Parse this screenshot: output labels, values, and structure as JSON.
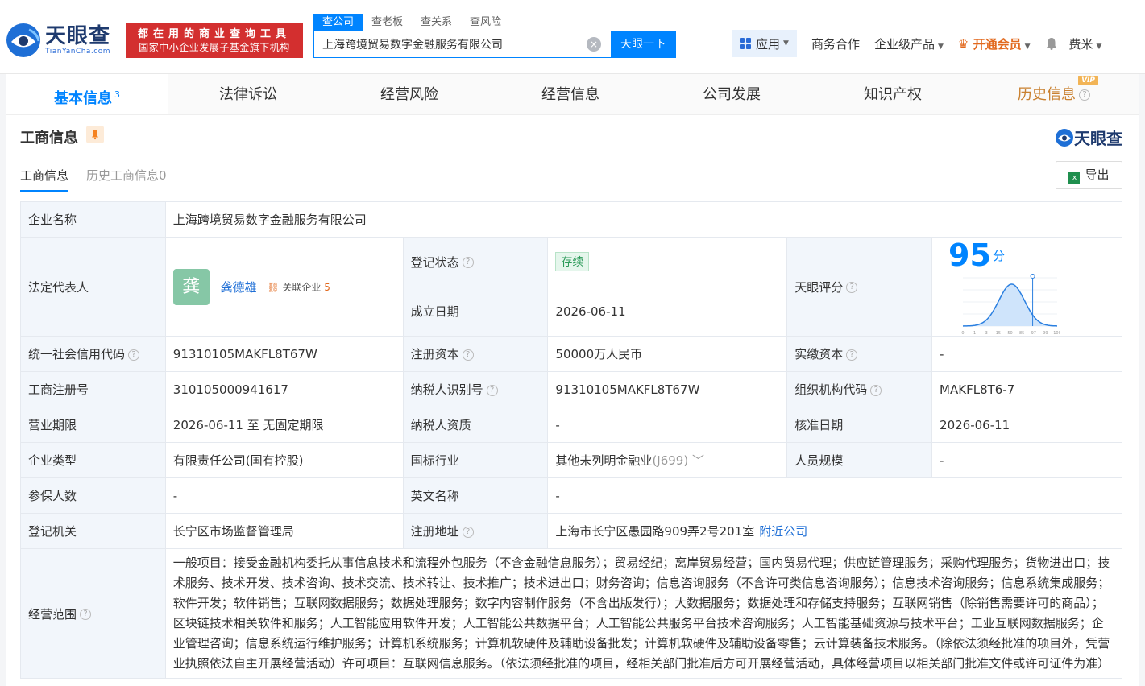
{
  "header": {
    "logo_cn": "天眼查",
    "logo_en": "TianYanCha.com",
    "slogan_line1": "都在用的商业查询工具",
    "slogan_line2": "国家中小企业发展子基金旗下机构",
    "search_tabs": [
      "查公司",
      "查老板",
      "查关系",
      "查风险"
    ],
    "search_value": "上海跨境贸易数字金融服务有限公司",
    "search_button": "天眼一下",
    "clear_icon": "×",
    "nav": {
      "app": "应用",
      "business": "商务合作",
      "enterprise": "企业级产品",
      "vip": "开通会员",
      "user": "费米"
    }
  },
  "main_tabs": [
    {
      "label": "基本信息",
      "count": "3"
    },
    {
      "label": "法律诉讼"
    },
    {
      "label": "经营风险"
    },
    {
      "label": "经营信息"
    },
    {
      "label": "公司发展"
    },
    {
      "label": "知识产权"
    },
    {
      "label": "历史信息",
      "badge": "VIP"
    }
  ],
  "section": {
    "title": "工商信息",
    "brand": "天眼查",
    "sub_tabs": [
      "工商信息",
      "历史工商信息0"
    ],
    "export": "导出"
  },
  "info": {
    "company_name_label": "企业名称",
    "company_name": "上海跨境贸易数字金融服务有限公司",
    "legal_rep_label": "法定代表人",
    "legal_rep_avatar": "龚",
    "legal_rep_name": "龚德雄",
    "related_label": "关联企业",
    "related_count": "5",
    "reg_status_label": "登记状态",
    "reg_status": "存续",
    "found_date_label": "成立日期",
    "found_date": "2026-06-11",
    "score_label": "天眼评分",
    "score": "95",
    "score_unit": "分",
    "credit_code_label": "统一社会信用代码",
    "credit_code": "91310105MAKFL8T67W",
    "reg_capital_label": "注册资本",
    "reg_capital": "50000万人民币",
    "paid_capital_label": "实缴资本",
    "paid_capital": "-",
    "reg_no_label": "工商注册号",
    "reg_no": "310105000941617",
    "taxpayer_id_label": "纳税人识别号",
    "taxpayer_id": "91310105MAKFL8T67W",
    "org_code_label": "组织机构代码",
    "org_code": "MAKFL8T6-7",
    "term_label": "营业期限",
    "term": "2026-06-11 至 无固定期限",
    "tax_qual_label": "纳税人资质",
    "tax_qual": "-",
    "approve_date_label": "核准日期",
    "approve_date": "2026-06-11",
    "type_label": "企业类型",
    "type": "有限责任公司(国有控股)",
    "industry_label": "国标行业",
    "industry": "其他未列明金融业",
    "industry_code": "(J699)",
    "staff_label": "人员规模",
    "staff": "-",
    "insured_label": "参保人数",
    "insured": "-",
    "en_name_label": "英文名称",
    "en_name": "-",
    "authority_label": "登记机关",
    "authority": "长宁区市场监督管理局",
    "address_label": "注册地址",
    "address": "上海市长宁区愚园路909弄2号201室",
    "nearby": "附近公司",
    "scope_label": "经营范围",
    "scope": "一般项目：接受金融机构委托从事信息技术和流程外包服务（不含金融信息服务）；贸易经纪；离岸贸易经营；国内贸易代理；供应链管理服务；采购代理服务；货物进出口；技术服务、技术开发、技术咨询、技术交流、技术转让、技术推广；技术进出口；财务咨询；信息咨询服务（不含许可类信息咨询服务）；信息技术咨询服务；信息系统集成服务；软件开发；软件销售；互联网数据服务；数据处理服务；数字内容制作服务（不含出版发行）；大数据服务；数据处理和存储支持服务；互联网销售（除销售需要许可的商品）；区块链技术相关软件和服务；人工智能应用软件开发；人工智能公共数据平台；人工智能公共服务平台技术咨询服务；人工智能基础资源与技术平台；工业互联网数据服务；企业管理咨询；信息系统运行维护服务；计算机系统服务；计算机软硬件及辅助设备批发；计算机软硬件及辅助设备零售；云计算装备技术服务。（除依法须经批准的项目外，凭营业执照依法自主开展经营活动）许可项目：互联网信息服务。（依法须经批准的项目，经相关部门批准后方可开展经营活动，具体经营项目以相关部门批准文件或许可证件为准）"
  },
  "score_chart_ticks": [
    "0",
    "1",
    "3",
    "15",
    "50",
    "85",
    "97",
    "99",
    "100"
  ],
  "colors": {
    "accent": "#0084ff",
    "brand": "#1e3a6e",
    "slogan": "#d32f2f",
    "vip": "#e2691e"
  }
}
